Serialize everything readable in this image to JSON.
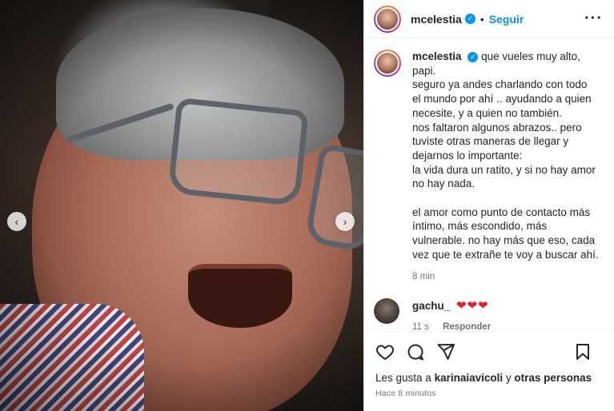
{
  "post": {
    "carousel_prev": "‹",
    "carousel_next": "›"
  },
  "header": {
    "username": "mcelestia",
    "verified": "✓",
    "separator": "•",
    "follow_label": "Seguir",
    "more": "···"
  },
  "caption": {
    "username": "mcelestia",
    "verified": "✓",
    "text": "que vueles muy alto,\npapi.\nseguro ya andes charlando con todo\nel mundo por ahí .. ayudando a quien\nnecesite, y a quien no también.\nnos faltaron algunos abrazos.. pero\ntuviste otras maneras de llegar y\ndejarnos lo importante:\nla vida dura un ratito, y si no hay amor\nno hay nada.\n\nel amor como punto de contacto más\níntimo, más escondido, más\nvulnerable. no hay más que eso, cada\nvez que te extrañe te voy a buscar ahí.",
    "time": "8 min"
  },
  "comments": [
    {
      "username": "gachu_",
      "text": "❤❤❤",
      "time": "11 s",
      "reply_label": "Responder"
    }
  ],
  "actions": {
    "likes_prefix": "Les gusta a ",
    "likes_user": "karinaiavicoli",
    "likes_conj": " y ",
    "likes_others": "otras personas",
    "posted_time": "Hace 8 minutos"
  },
  "colors": {
    "accent": "#0095f6",
    "heart": "#ed1c24",
    "muted": "#737373"
  },
  "icons": [
    "heart-icon",
    "comment-icon",
    "share-icon",
    "bookmark-icon",
    "more-icon",
    "verified-icon"
  ]
}
